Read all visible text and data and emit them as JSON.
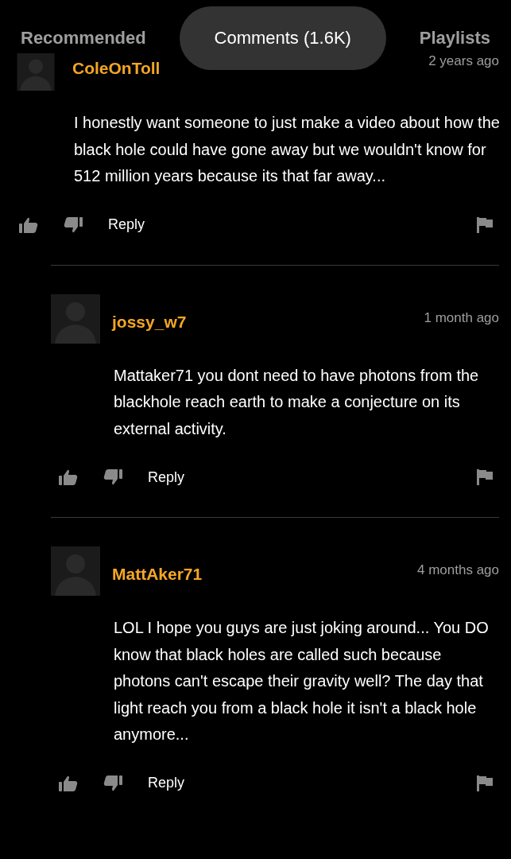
{
  "tabs": [
    {
      "label": "Recommended",
      "selected": false
    },
    {
      "label": "Comments (1.6K)",
      "selected": true
    },
    {
      "label": "Playlists",
      "selected": false
    }
  ],
  "comments": [
    {
      "author": "ColeOnToll",
      "time": "2 years ago",
      "reply": false,
      "text": "I honestly want someone to just make a video about how the black hole could have gone away but we wouldn't know for 512 million years because its that far away...",
      "action": "Reply"
    },
    {
      "author": "jossy_w7",
      "time": "1 month ago",
      "reply": true,
      "text": "Mattaker71 you dont need to have photons from the blackhole reach earth to make a conjecture on its external activity.",
      "action": "Reply"
    },
    {
      "author": "MattAker71",
      "time": "4 months ago",
      "reply": true,
      "text": "LOL I hope you guys are just joking around... You DO know that black holes are called such because photons can't escape their gravity well? The day that light reach you from a black hole it isn't a black hole anymore...",
      "action": "Reply"
    }
  ]
}
